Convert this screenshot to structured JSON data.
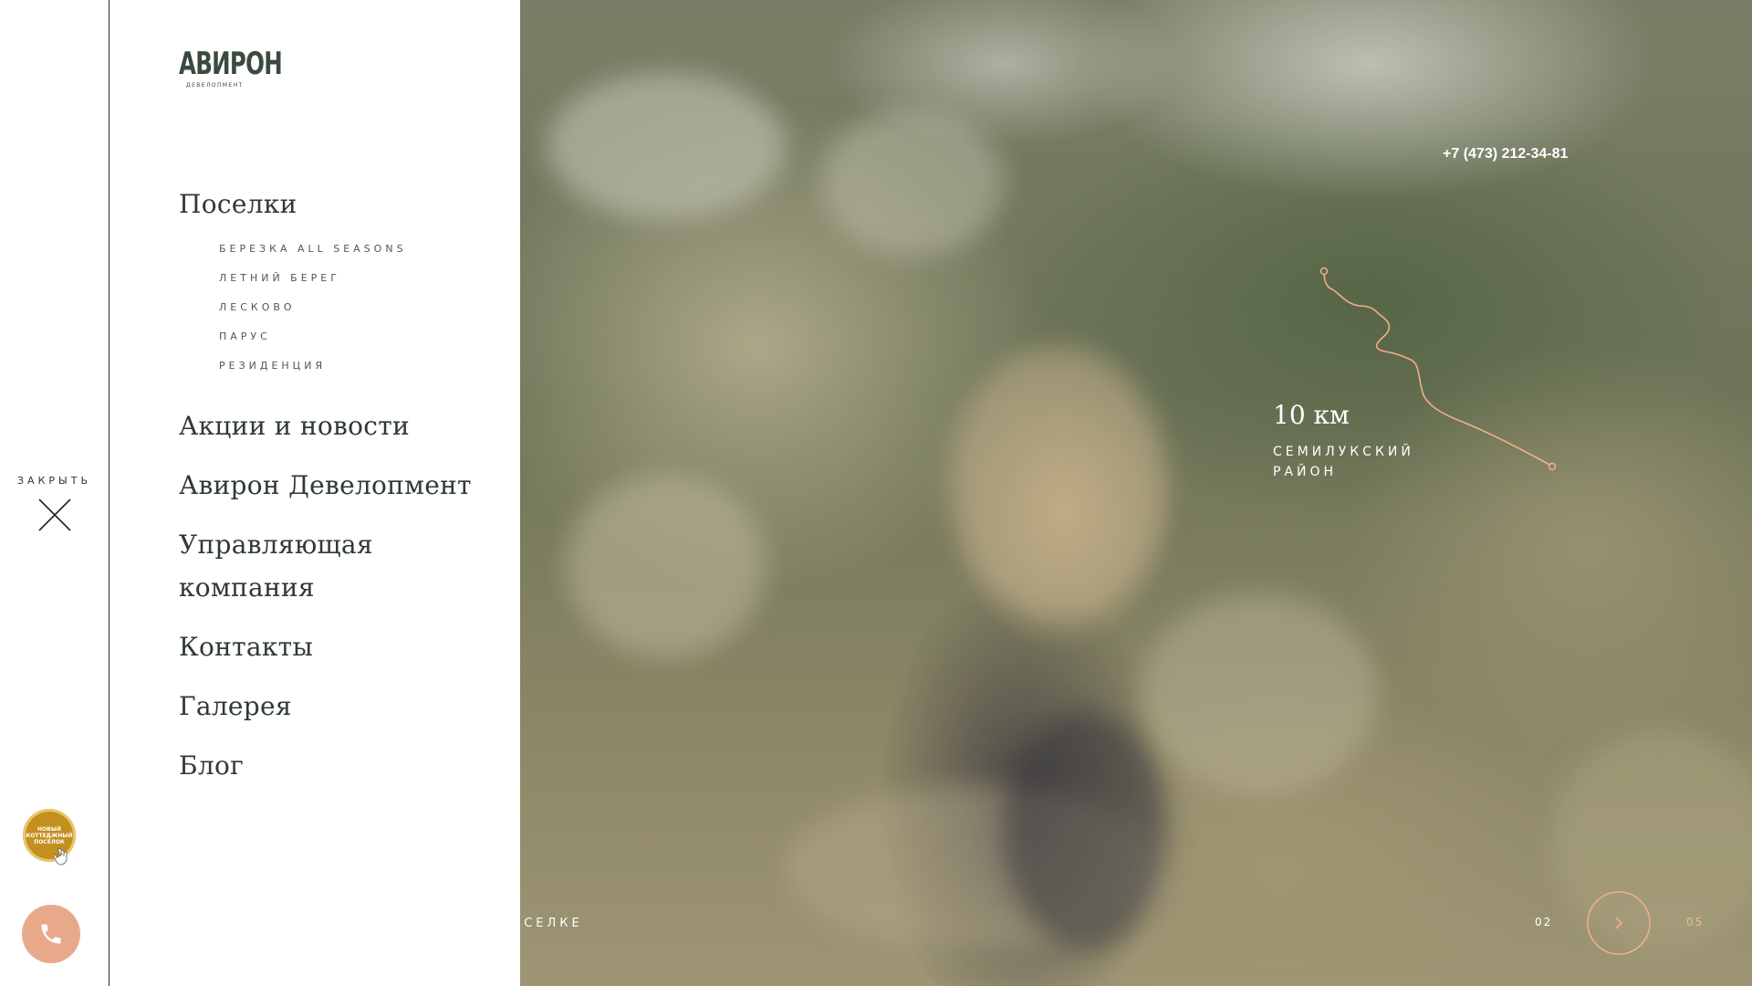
{
  "rail": {
    "close_label": "ЗАКРЫТЬ",
    "badge_text": "новый коттеджный посёлок"
  },
  "menu": {
    "logo_main": "АВИРОН",
    "logo_sub": "ДЕВЕЛОПМЕНТ",
    "settlements_label": "Поселки",
    "settlements": [
      "БЕРЕЗКА ALL SEASONS",
      "ЛЕТНИЙ БЕРЕГ",
      "ЛЕСКОВО",
      "ПАРУС",
      "РЕЗИДЕНЦИЯ"
    ],
    "items": [
      "Акции и новости",
      "Авирон Девелопмент",
      "Управляющая компания",
      "Контакты",
      "Галерея",
      "Блог"
    ]
  },
  "hero": {
    "phone": "+7 (473) 212-34-81",
    "distance_value": "10 км",
    "distance_label": "СЕМИЛУКСКИЙ РАЙОН",
    "bottom_caption": "ОСЕЛКЕ",
    "slide_current": "02",
    "slide_total": "05"
  },
  "colors": {
    "accent": "#e8a98a",
    "route": "#f0b08c",
    "menu_text": "#2f3a33",
    "badge": "#c38f1f"
  },
  "icons": [
    "close-icon",
    "phone-icon",
    "hand-pointer-icon",
    "chevron-right-icon"
  ]
}
